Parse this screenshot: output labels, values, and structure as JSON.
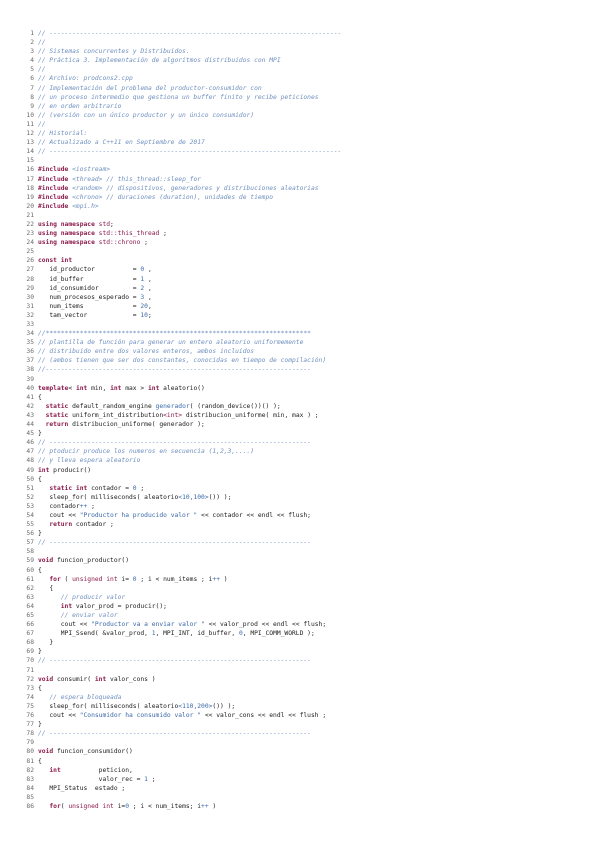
{
  "document": {
    "language": "cpp",
    "lines": [
      {
        "n": "1",
        "tokens": [
          [
            "c",
            "// -----------------------------------------------------------------------------"
          ]
        ]
      },
      {
        "n": "2",
        "tokens": [
          [
            "c",
            "//"
          ]
        ]
      },
      {
        "n": "3",
        "tokens": [
          [
            "c",
            "// Sistemas concurrentes y Distribuidos."
          ]
        ]
      },
      {
        "n": "4",
        "tokens": [
          [
            "c",
            "// Práctica 3. Implementación de algoritmos distribuidos con MPI"
          ]
        ]
      },
      {
        "n": "5",
        "tokens": [
          [
            "c",
            "//"
          ]
        ]
      },
      {
        "n": "6",
        "tokens": [
          [
            "c",
            "// Archivo: prodcons2.cpp"
          ]
        ]
      },
      {
        "n": "7",
        "tokens": [
          [
            "c",
            "// Implementación del problema del productor-consumidor con"
          ]
        ]
      },
      {
        "n": "8",
        "tokens": [
          [
            "c",
            "// un proceso intermedio que gestiona un buffer finito y recibe peticiones"
          ]
        ]
      },
      {
        "n": "9",
        "tokens": [
          [
            "c",
            "// en orden arbitrario"
          ]
        ]
      },
      {
        "n": "10",
        "tokens": [
          [
            "c",
            "// (versión con un único productor y un único consumidor)"
          ]
        ]
      },
      {
        "n": "11",
        "tokens": [
          [
            "c",
            "//"
          ]
        ]
      },
      {
        "n": "12",
        "tokens": [
          [
            "c",
            "// Historial:"
          ]
        ]
      },
      {
        "n": "13",
        "tokens": [
          [
            "c",
            "// Actualizado a C++11 en Septiembre de 2017"
          ]
        ]
      },
      {
        "n": "14",
        "tokens": [
          [
            "c",
            "// -----------------------------------------------------------------------------"
          ]
        ]
      },
      {
        "n": "15",
        "tokens": []
      },
      {
        "n": "16",
        "tokens": [
          [
            "k",
            "#include "
          ],
          [
            "c",
            "<iostream>"
          ]
        ]
      },
      {
        "n": "17",
        "tokens": [
          [
            "k",
            "#include "
          ],
          [
            "c",
            "<thread> // this_thread::sleep_for"
          ]
        ]
      },
      {
        "n": "18",
        "tokens": [
          [
            "k",
            "#include "
          ],
          [
            "c",
            "<random> // dispositivos, generadores y distribuciones aleatorias"
          ]
        ]
      },
      {
        "n": "19",
        "tokens": [
          [
            "k",
            "#include "
          ],
          [
            "c",
            "<chrono> // duraciones (duration), unidades de tiempo"
          ]
        ]
      },
      {
        "n": "20",
        "tokens": [
          [
            "k",
            "#include "
          ],
          [
            "c",
            "<mpi.h>"
          ]
        ]
      },
      {
        "n": "21",
        "tokens": []
      },
      {
        "n": "22",
        "tokens": [
          [
            "k",
            "using namespace "
          ],
          [
            "t",
            "std"
          ],
          [
            "p",
            ";"
          ]
        ]
      },
      {
        "n": "23",
        "tokens": [
          [
            "k",
            "using namespace "
          ],
          [
            "t",
            "std::this_thread"
          ],
          [
            "p",
            " ;"
          ]
        ]
      },
      {
        "n": "24",
        "tokens": [
          [
            "k",
            "using namespace "
          ],
          [
            "t",
            "std::chrono"
          ],
          [
            "p",
            " ;"
          ]
        ]
      },
      {
        "n": "25",
        "tokens": []
      },
      {
        "n": "26",
        "tokens": [
          [
            "k",
            "const int"
          ]
        ]
      },
      {
        "n": "27",
        "tokens": [
          [
            "p",
            "   id_productor          = "
          ],
          [
            "n",
            "0"
          ],
          [
            "p",
            " ,"
          ]
        ]
      },
      {
        "n": "28",
        "tokens": [
          [
            "p",
            "   id_buffer             = "
          ],
          [
            "n",
            "1"
          ],
          [
            "p",
            " ,"
          ]
        ]
      },
      {
        "n": "29",
        "tokens": [
          [
            "p",
            "   id_consumidor         = "
          ],
          [
            "n",
            "2"
          ],
          [
            "p",
            " ,"
          ]
        ]
      },
      {
        "n": "30",
        "tokens": [
          [
            "p",
            "   num_procesos_esperado = "
          ],
          [
            "n",
            "3"
          ],
          [
            "p",
            " ,"
          ]
        ]
      },
      {
        "n": "31",
        "tokens": [
          [
            "p",
            "   num_items             = "
          ],
          [
            "n",
            "20"
          ],
          [
            "p",
            ","
          ]
        ]
      },
      {
        "n": "32",
        "tokens": [
          [
            "p",
            "   tam_vector            = "
          ],
          [
            "n",
            "10"
          ],
          [
            "p",
            ";"
          ]
        ]
      },
      {
        "n": "33",
        "tokens": []
      },
      {
        "n": "34",
        "tokens": [
          [
            "c",
            "//**********************************************************************"
          ]
        ]
      },
      {
        "n": "35",
        "tokens": [
          [
            "c",
            "// plantilla de función para generar un entero aleatorio uniformemente"
          ]
        ]
      },
      {
        "n": "36",
        "tokens": [
          [
            "c",
            "// distribuido entre dos valores enteros, ambos incluidos"
          ]
        ]
      },
      {
        "n": "37",
        "tokens": [
          [
            "c",
            "// (ambos tienen que ser dos constantes, conocidas en tiempo de compilación)"
          ]
        ]
      },
      {
        "n": "38",
        "tokens": [
          [
            "c",
            "//----------------------------------------------------------------------"
          ]
        ]
      },
      {
        "n": "39",
        "tokens": []
      },
      {
        "n": "40",
        "tokens": [
          [
            "k",
            "template"
          ],
          [
            "p",
            "< "
          ],
          [
            "k",
            "int"
          ],
          [
            "p",
            " min, "
          ],
          [
            "k",
            "int"
          ],
          [
            "p",
            " max > "
          ],
          [
            "k",
            "int"
          ],
          [
            "p",
            " aleatorio()"
          ]
        ]
      },
      {
        "n": "41",
        "tokens": [
          [
            "p",
            "{"
          ]
        ]
      },
      {
        "n": "42",
        "tokens": [
          [
            "p",
            "  "
          ],
          [
            "k",
            "static"
          ],
          [
            "p",
            " default_random_engine "
          ],
          [
            "s",
            "generador"
          ],
          [
            "p",
            "( (random_device())() );"
          ]
        ]
      },
      {
        "n": "43",
        "tokens": [
          [
            "p",
            "  "
          ],
          [
            "k",
            "static"
          ],
          [
            "p",
            " uniform_int_distribution"
          ],
          [
            "t",
            "<int>"
          ],
          [
            "p",
            " distribucion_uniforme( min, max ) ;"
          ]
        ]
      },
      {
        "n": "44",
        "tokens": [
          [
            "p",
            "  "
          ],
          [
            "k",
            "return"
          ],
          [
            "p",
            " distribucion_uniforme( generador );"
          ]
        ]
      },
      {
        "n": "45",
        "tokens": [
          [
            "p",
            "}"
          ]
        ]
      },
      {
        "n": "46",
        "tokens": [
          [
            "c",
            "// ---------------------------------------------------------------------"
          ]
        ]
      },
      {
        "n": "47",
        "tokens": [
          [
            "c",
            "// ptoducir produce los numeros en secuencia (1,2,3,....)"
          ]
        ]
      },
      {
        "n": "48",
        "tokens": [
          [
            "c",
            "// y lleva espera aleatorio"
          ]
        ]
      },
      {
        "n": "49",
        "tokens": [
          [
            "k",
            "int"
          ],
          [
            "p",
            " producir()"
          ]
        ]
      },
      {
        "n": "50",
        "tokens": [
          [
            "p",
            "{"
          ]
        ]
      },
      {
        "n": "51",
        "tokens": [
          [
            "p",
            "   "
          ],
          [
            "k",
            "static int"
          ],
          [
            "p",
            " contador = "
          ],
          [
            "n",
            "0"
          ],
          [
            "p",
            " ;"
          ]
        ]
      },
      {
        "n": "52",
        "tokens": [
          [
            "p",
            "   sleep_for( milliseconds( aleatorio"
          ],
          [
            "n",
            "<10,100>"
          ],
          [
            "p",
            "()) );"
          ]
        ]
      },
      {
        "n": "53",
        "tokens": [
          [
            "p",
            "   contador"
          ],
          [
            "n",
            "++"
          ],
          [
            "p",
            " ;"
          ]
        ]
      },
      {
        "n": "54",
        "tokens": [
          [
            "p",
            "   cout << "
          ],
          [
            "s",
            "\"Productor ha producido valor \""
          ],
          [
            "p",
            " << contador << endl << flush;"
          ]
        ]
      },
      {
        "n": "55",
        "tokens": [
          [
            "p",
            "   "
          ],
          [
            "k",
            "return"
          ],
          [
            "p",
            " contador ;"
          ]
        ]
      },
      {
        "n": "56",
        "tokens": [
          [
            "p",
            "}"
          ]
        ]
      },
      {
        "n": "57",
        "tokens": [
          [
            "c",
            "// ---------------------------------------------------------------------"
          ]
        ]
      },
      {
        "n": "58",
        "tokens": []
      },
      {
        "n": "59",
        "tokens": [
          [
            "k",
            "void"
          ],
          [
            "p",
            " funcion_productor()"
          ]
        ]
      },
      {
        "n": "60",
        "tokens": [
          [
            "p",
            "{"
          ]
        ]
      },
      {
        "n": "61",
        "tokens": [
          [
            "p",
            "   "
          ],
          [
            "k",
            "for"
          ],
          [
            "p",
            " ( "
          ],
          [
            "t",
            "unsigned int"
          ],
          [
            "p",
            " i= "
          ],
          [
            "n",
            "0"
          ],
          [
            "p",
            " ; i < num_items ; i"
          ],
          [
            "n",
            "++"
          ],
          [
            "p",
            " )"
          ]
        ]
      },
      {
        "n": "62",
        "tokens": [
          [
            "p",
            "   {"
          ]
        ]
      },
      {
        "n": "63",
        "tokens": [
          [
            "p",
            "      "
          ],
          [
            "c",
            "// producir valor"
          ]
        ]
      },
      {
        "n": "64",
        "tokens": [
          [
            "p",
            "      "
          ],
          [
            "k",
            "int"
          ],
          [
            "p",
            " valor_prod = producir();"
          ]
        ]
      },
      {
        "n": "65",
        "tokens": [
          [
            "p",
            "      "
          ],
          [
            "c",
            "// enviar valor"
          ]
        ]
      },
      {
        "n": "66",
        "tokens": [
          [
            "p",
            "      cout << "
          ],
          [
            "s",
            "\"Productor va a enviar valor \""
          ],
          [
            "p",
            " << valor_prod << endl << flush;"
          ]
        ]
      },
      {
        "n": "67",
        "tokens": [
          [
            "p",
            "      MPI_Ssend( &valor_prod, "
          ],
          [
            "n",
            "1"
          ],
          [
            "p",
            ", MPI_INT, id_buffer, "
          ],
          [
            "n",
            "0"
          ],
          [
            "p",
            ", MPI_COMM_WORLD );"
          ]
        ]
      },
      {
        "n": "68",
        "tokens": [
          [
            "p",
            "   }"
          ]
        ]
      },
      {
        "n": "69",
        "tokens": [
          [
            "p",
            "}"
          ]
        ]
      },
      {
        "n": "70",
        "tokens": [
          [
            "c",
            "// ---------------------------------------------------------------------"
          ]
        ]
      },
      {
        "n": "71",
        "tokens": []
      },
      {
        "n": "72",
        "tokens": [
          [
            "k",
            "void"
          ],
          [
            "p",
            " consumir( "
          ],
          [
            "k",
            "int"
          ],
          [
            "p",
            " valor_cons )"
          ]
        ]
      },
      {
        "n": "73",
        "tokens": [
          [
            "p",
            "{"
          ]
        ]
      },
      {
        "n": "74",
        "tokens": [
          [
            "p",
            "   "
          ],
          [
            "c",
            "// espera bloqueada"
          ]
        ]
      },
      {
        "n": "75",
        "tokens": [
          [
            "p",
            "   sleep_for( milliseconds( aleatorio"
          ],
          [
            "n",
            "<110,200>"
          ],
          [
            "p",
            "()) );"
          ]
        ]
      },
      {
        "n": "76",
        "tokens": [
          [
            "p",
            "   cout << "
          ],
          [
            "s",
            "\"Consumidor ha consumido valor \""
          ],
          [
            "p",
            " << valor_cons << endl << flush ;"
          ]
        ]
      },
      {
        "n": "77",
        "tokens": [
          [
            "p",
            "}"
          ]
        ]
      },
      {
        "n": "78",
        "tokens": [
          [
            "c",
            "// ---------------------------------------------------------------------"
          ]
        ]
      },
      {
        "n": "79",
        "tokens": []
      },
      {
        "n": "80",
        "tokens": [
          [
            "k",
            "void"
          ],
          [
            "p",
            " funcion_consumidor()"
          ]
        ]
      },
      {
        "n": "81",
        "tokens": [
          [
            "p",
            "{"
          ]
        ]
      },
      {
        "n": "82",
        "tokens": [
          [
            "p",
            "   "
          ],
          [
            "k",
            "int"
          ],
          [
            "p",
            "          peticion,"
          ]
        ]
      },
      {
        "n": "83",
        "tokens": [
          [
            "p",
            "                valor_rec = "
          ],
          [
            "n",
            "1"
          ],
          [
            "p",
            " ;"
          ]
        ]
      },
      {
        "n": "84",
        "tokens": [
          [
            "p",
            "   MPI_Status  estado ;"
          ]
        ]
      },
      {
        "n": "85",
        "tokens": []
      },
      {
        "n": "86",
        "tokens": [
          [
            "p",
            "   "
          ],
          [
            "k",
            "for"
          ],
          [
            "p",
            "( "
          ],
          [
            "t",
            "unsigned int"
          ],
          [
            "p",
            " i="
          ],
          [
            "n",
            "0"
          ],
          [
            "p",
            " ; i < num_items; i"
          ],
          [
            "n",
            "++"
          ],
          [
            "p",
            " )"
          ]
        ]
      }
    ]
  },
  "colors": {
    "comment": "#6e8fbf",
    "keyword": "#8b1a4b",
    "string": "#3a68a8",
    "number": "#3a68a8",
    "line_number": "#6a6a6a",
    "text": "#1c1c1c"
  }
}
